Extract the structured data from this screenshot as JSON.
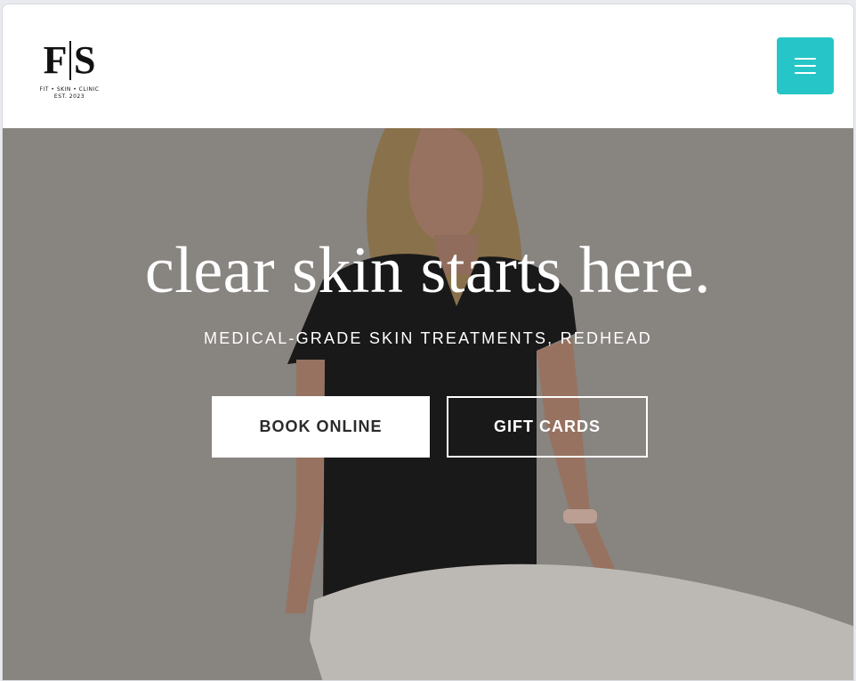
{
  "header": {
    "logo": {
      "mark_left": "F",
      "mark_right": "S",
      "tagline": "FIT • SKIN • CLINIC",
      "established": "EST. 2023"
    },
    "menu_icon": "hamburger-menu-icon"
  },
  "hero": {
    "headline": "clear skin starts here.",
    "subheadline": "MEDICAL-GRADE SKIN TREATMENTS, REDHEAD",
    "book_label": "BOOK ONLINE",
    "gift_label": "GIFT CARDS"
  },
  "colors": {
    "accent": "#26c6c8",
    "hero_text": "#ffffff",
    "button_text_dark": "#2b2b2b"
  }
}
